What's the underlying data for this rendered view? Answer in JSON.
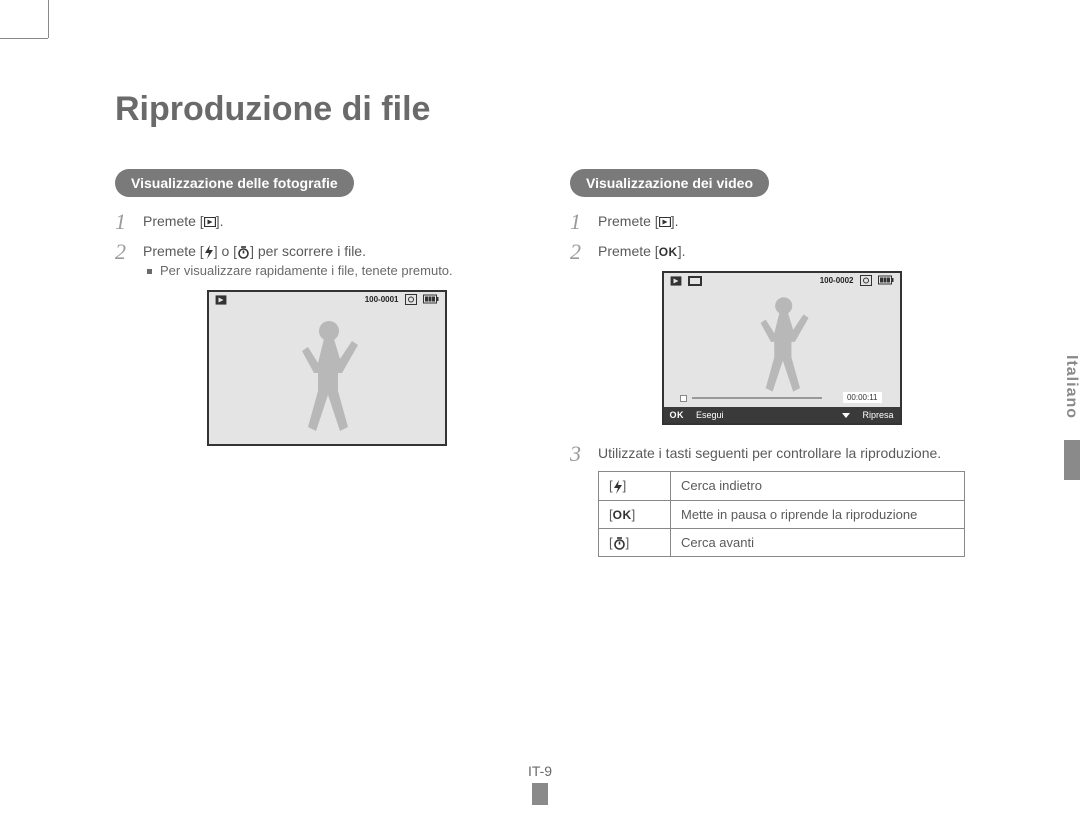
{
  "title": "Riproduzione di file",
  "sideTab": "Italiano",
  "pageNumber": "IT-9",
  "photo": {
    "heading": "Visualizzazione delle fotografie",
    "step1_a": "Premete [",
    "step1_b": "].",
    "step2_a": "Premete [",
    "step2_b": "] o [",
    "step2_c": "] per scorrere i file.",
    "bullet": "Per visualizzare rapidamente i file, tenete premuto.",
    "screen": {
      "fileNo": "100-0001"
    }
  },
  "video": {
    "heading": "Visualizzazione dei video",
    "step1_a": "Premete [",
    "step1_b": "].",
    "step2_a": "Premete [",
    "step2_b": "].",
    "step3": "Utilizzate i tasti seguenti per controllare la riproduzione.",
    "screen": {
      "fileNo": "100-0002",
      "time": "00:00:11",
      "leftLabel": "Esegui",
      "rightLabel": "Ripresa"
    },
    "table": {
      "r1": "Cerca indietro",
      "r2": "Mette in pausa o riprende la riproduzione",
      "r3": "Cerca avanti"
    }
  },
  "okLabel": "OK"
}
